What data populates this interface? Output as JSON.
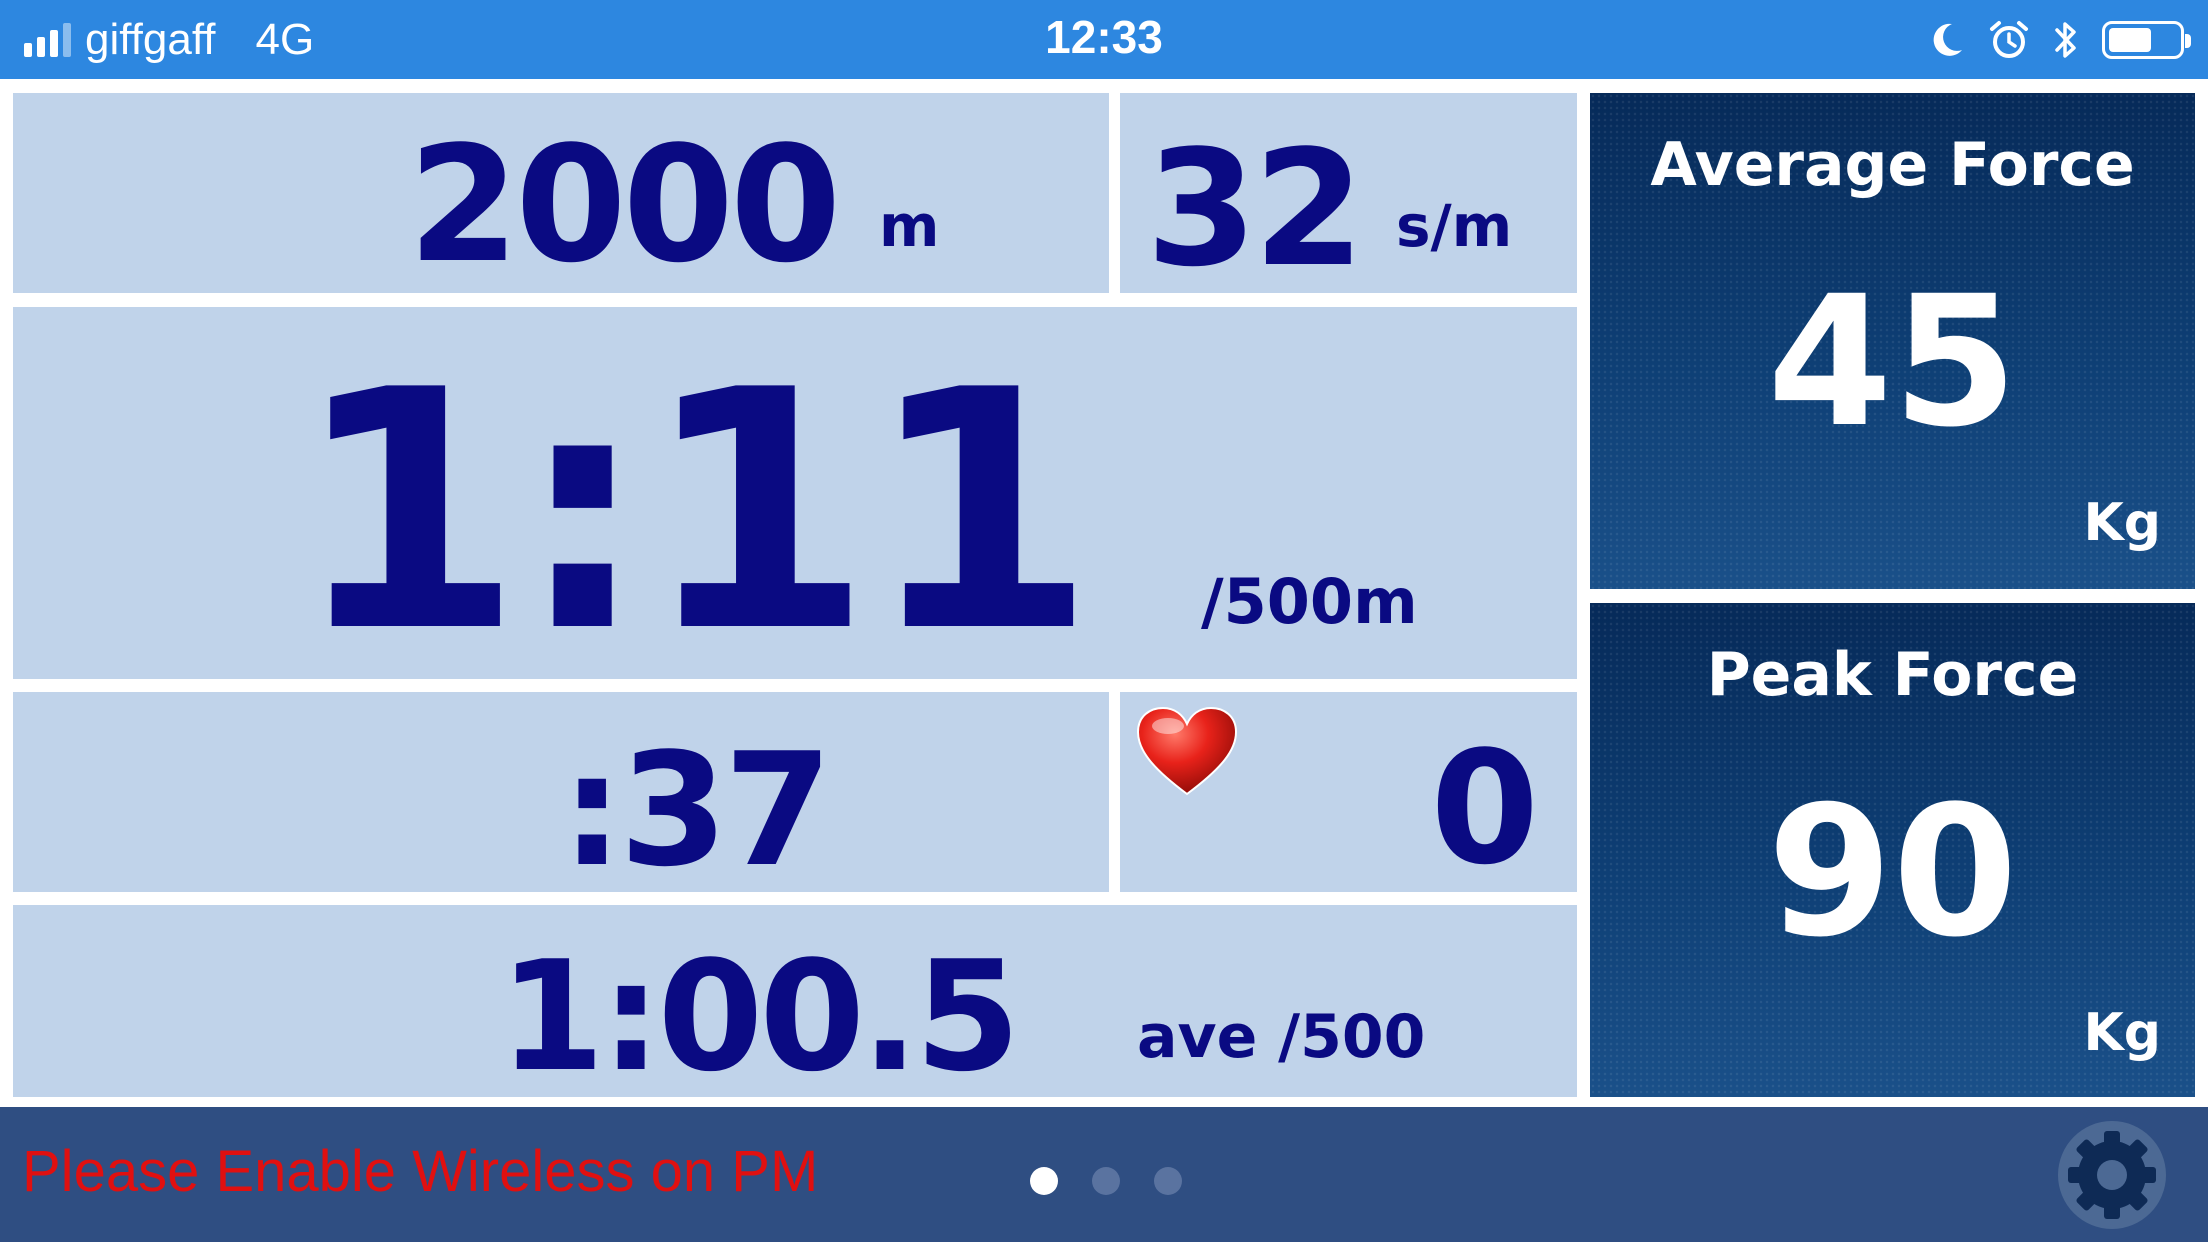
{
  "status_bar": {
    "carrier": "giffgaff",
    "network": "4G",
    "time": "12:33",
    "icons": [
      "moon-icon",
      "alarm-icon",
      "bluetooth-icon",
      "battery-icon"
    ],
    "signal_bars_active": 3,
    "signal_bars_total": 4,
    "battery_level": 0.55
  },
  "metrics": {
    "distance": {
      "value": "2000",
      "unit": "m"
    },
    "stroke_rate": {
      "value": "32",
      "unit": "s/m"
    },
    "split": {
      "value": "1:11",
      "unit": "/500m"
    },
    "elapsed": {
      "value": ":37"
    },
    "heart_rate": {
      "value": "0",
      "icon": "heart-icon"
    },
    "average_split": {
      "value": "1:00.5",
      "unit": "ave /500"
    }
  },
  "force": {
    "average": {
      "title": "Average Force",
      "value": "45",
      "unit": "Kg"
    },
    "peak": {
      "title": "Peak Force",
      "value": "90",
      "unit": "Kg"
    }
  },
  "bottom_bar": {
    "message": "Please Enable Wireless on PM",
    "pages_total": 3,
    "page_active": 1,
    "settings_icon": "gear-icon"
  },
  "colors": {
    "status_bar": "#2d87e0",
    "panel_bg": "#c0d3ea",
    "panel_text": "#0a0a82",
    "force_panel_bg": "#0d3a6e",
    "bottom_bar": "#2f4e82",
    "warning_text": "#e01010"
  }
}
